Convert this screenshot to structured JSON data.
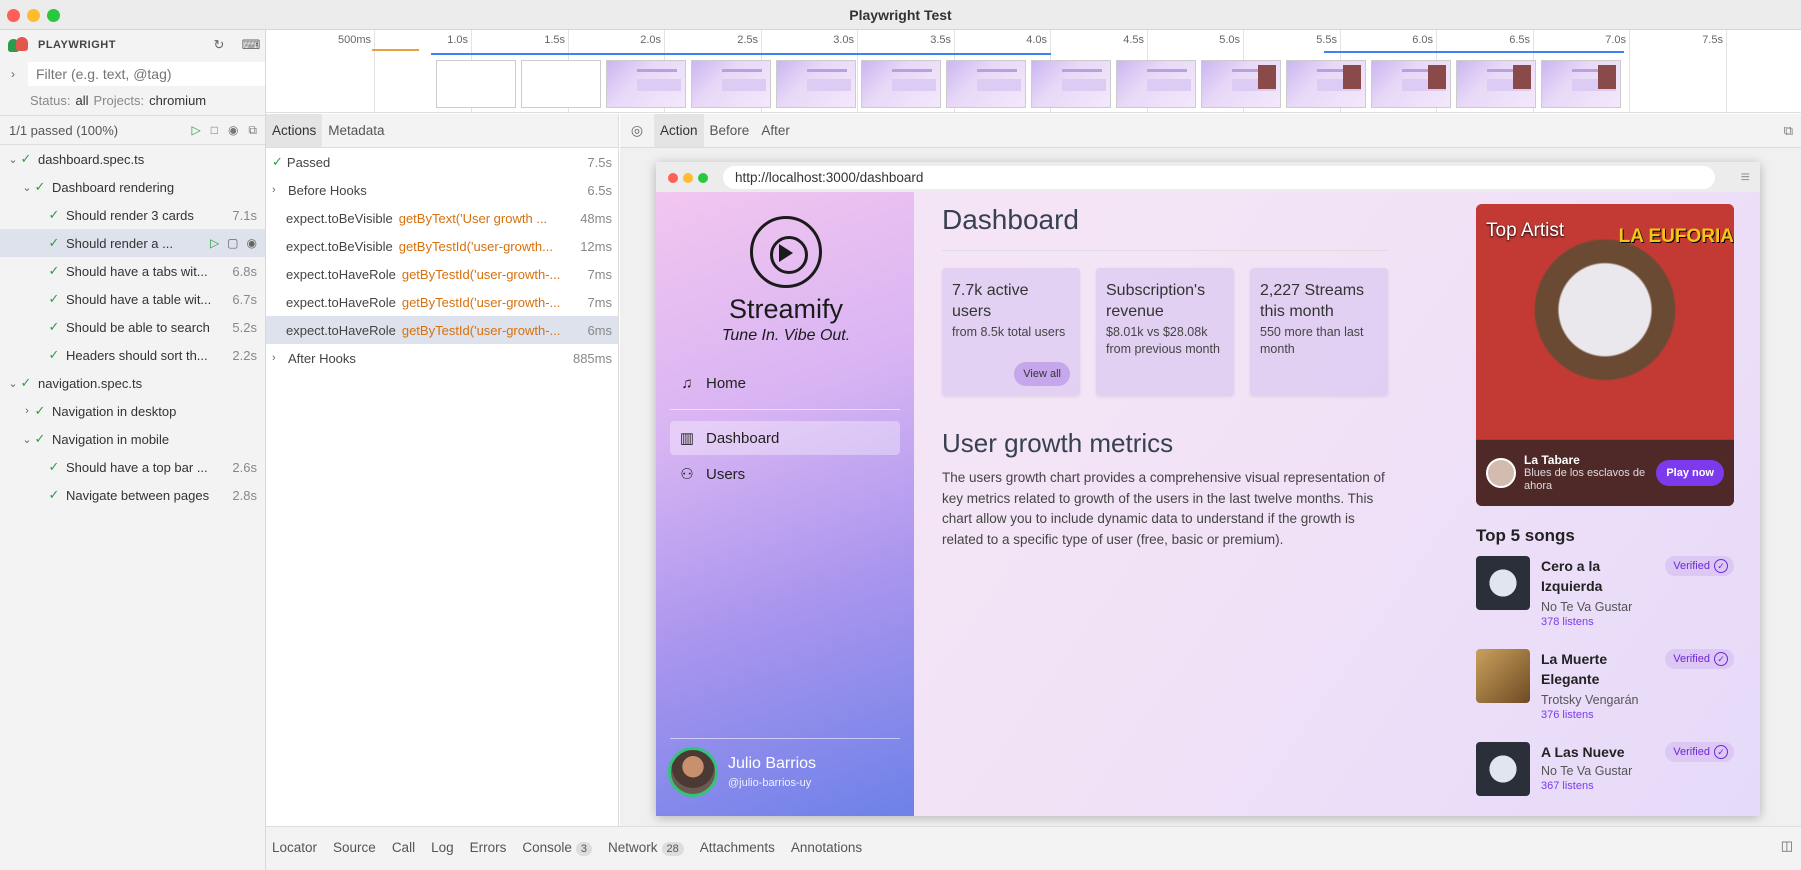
{
  "window": {
    "title": "Playwright Test"
  },
  "sidebar": {
    "app_name": "PLAYWRIGHT",
    "filter_placeholder": "Filter (e.g. text, @tag)",
    "status_label": "Status:",
    "status_value": "all",
    "projects_label": "Projects:",
    "projects_value": "chromium",
    "passed_summary": "1/1 passed (100%)",
    "tree": [
      {
        "label": "dashboard.spec.ts",
        "duration": ""
      },
      {
        "label": "Dashboard rendering",
        "duration": ""
      },
      {
        "label": "Should render 3 cards",
        "duration": "7.1s"
      },
      {
        "label": "Should render a ...",
        "duration": ""
      },
      {
        "label": "Should have a tabs wit...",
        "duration": "6.8s"
      },
      {
        "label": "Should have a table wit...",
        "duration": "6.7s"
      },
      {
        "label": "Should be able to search",
        "duration": "5.2s"
      },
      {
        "label": "Headers should sort th...",
        "duration": "2.2s"
      },
      {
        "label": "navigation.spec.ts",
        "duration": ""
      },
      {
        "label": "Navigation in desktop",
        "duration": ""
      },
      {
        "label": "Navigation in mobile",
        "duration": ""
      },
      {
        "label": "Should have a top bar ...",
        "duration": "2.6s"
      },
      {
        "label": "Navigate between pages",
        "duration": "2.8s"
      }
    ]
  },
  "timeline": {
    "ticks": [
      "500ms",
      "1.0s",
      "1.5s",
      "2.0s",
      "2.5s",
      "3.0s",
      "3.5s",
      "4.0s",
      "4.5s",
      "5.0s",
      "5.5s",
      "6.0s",
      "6.5s",
      "7.0s",
      "7.5s"
    ],
    "colors": {
      "orange": "#e8a040",
      "blue": "#3b82f6"
    }
  },
  "actions_panel": {
    "tabs": [
      "Actions",
      "Metadata"
    ],
    "rows": [
      {
        "name": "Passed",
        "selector": "",
        "duration": "7.5s"
      },
      {
        "name": "Before Hooks",
        "selector": "",
        "duration": "6.5s"
      },
      {
        "name": "expect.toBeVisible",
        "selector": "getByText('User growth ...",
        "duration": "48ms"
      },
      {
        "name": "expect.toBeVisible",
        "selector": "getByTestId('user-growth...",
        "duration": "12ms"
      },
      {
        "name": "expect.toHaveRole",
        "selector": "getByTestId('user-growth-...",
        "duration": "7ms"
      },
      {
        "name": "expect.toHaveRole",
        "selector": "getByTestId('user-growth-...",
        "duration": "7ms"
      },
      {
        "name": "expect.toHaveRole",
        "selector": "getByTestId('user-growth-...",
        "duration": "6ms"
      },
      {
        "name": "After Hooks",
        "selector": "",
        "duration": "885ms"
      }
    ]
  },
  "snapshot_tabs": [
    "Action",
    "Before",
    "After"
  ],
  "browser": {
    "url": "http://localhost:3000/dashboard"
  },
  "app": {
    "brand": {
      "name": "Streamify",
      "tagline": "Tune In. Vibe Out."
    },
    "nav": [
      {
        "label": "Home",
        "icon": "music-note-icon"
      },
      {
        "label": "Dashboard",
        "icon": "bar-chart-icon"
      },
      {
        "label": "Users",
        "icon": "users-icon"
      }
    ],
    "user": {
      "name": "Julio Barrios",
      "handle": "@julio-barrios-uy"
    },
    "page_title": "Dashboard",
    "cards": [
      {
        "title": "7.7k active users",
        "subtitle": "from 8.5k total users",
        "button": "View all"
      },
      {
        "title": "Subscription's revenue",
        "subtitle": "$8.01k vs $28.08k from previous month",
        "button": ""
      },
      {
        "title": "2,227 Streams this month",
        "subtitle": "550 more than last month",
        "button": ""
      }
    ],
    "section_title": "User growth metrics",
    "section_text": "The users growth chart provides a comprehensive visual representation of key metrics related to growth of the users in the last twelve months. This chart allow you to include dynamic data to understand if the growth is related to a specific type of user (free, basic or premium).",
    "top_artist": {
      "label": "Top Artist",
      "banner": "LA EUFORIA",
      "name": "La Tabare",
      "album": "Blues de los esclavos de ahora",
      "button": "Play now"
    },
    "top_songs_title": "Top 5 songs",
    "songs": [
      {
        "title": "Cero a la Izquierda",
        "artist": "No Te Va Gustar",
        "listens": "378 listens",
        "badge": "Verified"
      },
      {
        "title": "La Muerte Elegante",
        "artist": "Trotsky Vengarán",
        "listens": "376 listens",
        "badge": "Verified"
      },
      {
        "title": "A Las Nueve",
        "artist": "No Te Va Gustar",
        "listens": "367 listens",
        "badge": "Verified"
      }
    ]
  },
  "bottom_tabs": [
    {
      "label": "Locator",
      "count": ""
    },
    {
      "label": "Source",
      "count": ""
    },
    {
      "label": "Call",
      "count": ""
    },
    {
      "label": "Log",
      "count": ""
    },
    {
      "label": "Errors",
      "count": ""
    },
    {
      "label": "Console",
      "count": "3"
    },
    {
      "label": "Network",
      "count": "28"
    },
    {
      "label": "Attachments",
      "count": ""
    },
    {
      "label": "Annotations",
      "count": ""
    }
  ]
}
